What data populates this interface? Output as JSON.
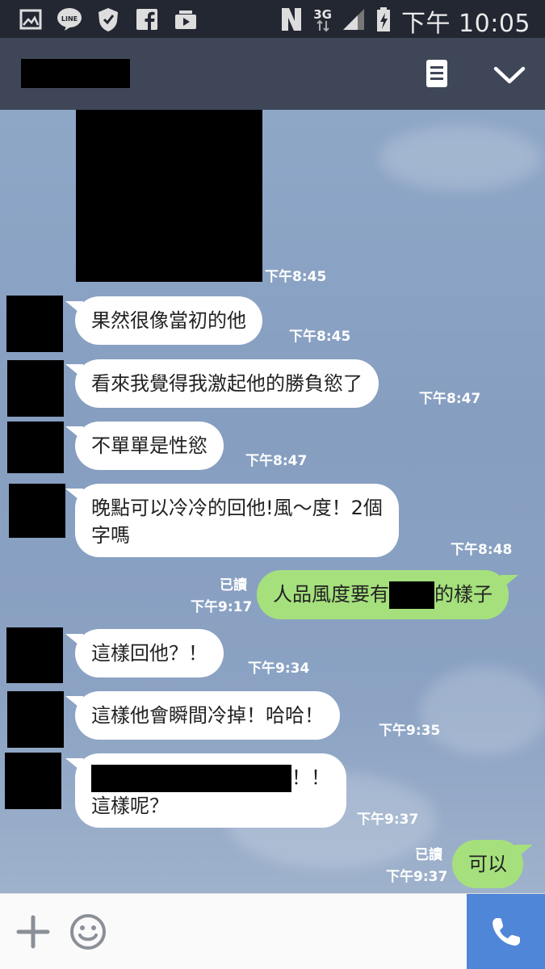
{
  "status_bar": {
    "icons": [
      "gallery-icon",
      "line-icon",
      "vpn-shield-icon",
      "facebook-icon",
      "media-play-icon",
      "nfc-icon",
      "signal-icon",
      "battery-icon"
    ],
    "network": "3G",
    "time": "下午 10:05"
  },
  "header": {
    "notes_icon": "notes-icon",
    "menu_icon": "chevron-down-icon"
  },
  "messages": [
    {
      "type": "incoming-photo",
      "time": "下午8:45"
    },
    {
      "type": "incoming",
      "text": "果然很像當初的他",
      "time": "下午8:45"
    },
    {
      "type": "incoming",
      "text": "看來我覺得我激起他的勝負慾了",
      "time": "下午8:47"
    },
    {
      "type": "incoming",
      "text": "不單單是性慾",
      "time": "下午8:47"
    },
    {
      "type": "incoming",
      "line1": "晚點可以冷冷的回他!風～度！2個",
      "line2": "字嗎",
      "time": "下午8:48"
    },
    {
      "type": "outgoing",
      "text_before": "人品風度要有",
      "text_after": "的樣子",
      "read": "已讀",
      "time": "下午9:17"
    },
    {
      "type": "incoming",
      "text": "這樣回他？！",
      "time": "下午9:34"
    },
    {
      "type": "incoming",
      "text": "這樣他會瞬間冷掉！哈哈！",
      "time": "下午9:35"
    },
    {
      "type": "incoming",
      "line1_after": "！！",
      "line2": "這樣呢？",
      "time": "下午9:37"
    },
    {
      "type": "outgoing",
      "text": "可以",
      "read": "已讀",
      "time": "下午9:37"
    }
  ],
  "input_bar": {
    "plus_icon": "plus-icon",
    "emoji_icon": "emoji-icon",
    "call_icon": "phone-icon"
  },
  "colors": {
    "status_bar": "#232732",
    "header": "#3e4658",
    "outgoing_bubble": "#a5e07d",
    "incoming_bubble": "#ffffff",
    "call_button": "#4f86d8"
  }
}
